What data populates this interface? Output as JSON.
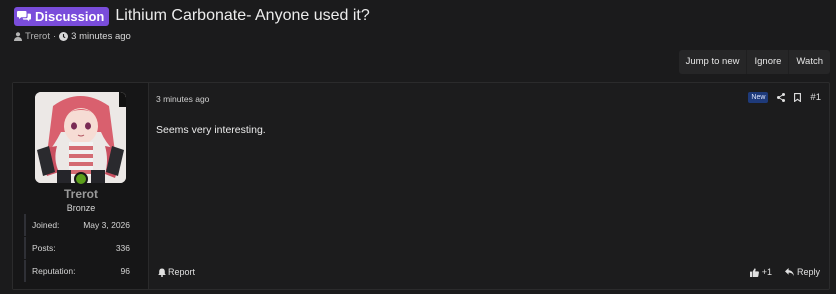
{
  "thread": {
    "prefix_label": "Discussion",
    "title": "Lithium Carbonate- Anyone used it?",
    "author": "Trerot",
    "separator": "·",
    "started": "3 minutes ago"
  },
  "thread_buttons": {
    "jump_to_new": "Jump to new",
    "ignore": "Ignore",
    "watch": "Watch"
  },
  "post": {
    "author": {
      "username": "Trerot",
      "user_title": "Bronze",
      "online": true,
      "stats": [
        {
          "label": "Joined:",
          "value": "May 3, 2026"
        },
        {
          "label": "Posts:",
          "value": "336"
        },
        {
          "label": "Reputation:",
          "value": "96"
        }
      ]
    },
    "date": "3 minutes ago",
    "new_badge": "New",
    "number": "#1",
    "body": "Seems very interesting.",
    "report_label": "Report",
    "reaction_label": "+1",
    "reply_label": "Reply"
  },
  "icons": {
    "prefix": "chat-bubbles-icon",
    "author": "user-icon",
    "time": "clock-icon",
    "share": "share-icon",
    "bookmark": "bookmark-icon",
    "report": "bell-icon",
    "like": "thumbs-up-icon",
    "reply": "reply-icon"
  },
  "colors": {
    "background": "#1b1b1c",
    "prefix_badge": "#7a4ddb",
    "new_badge": "#1e3a7a",
    "online": "#5c9e1b"
  }
}
